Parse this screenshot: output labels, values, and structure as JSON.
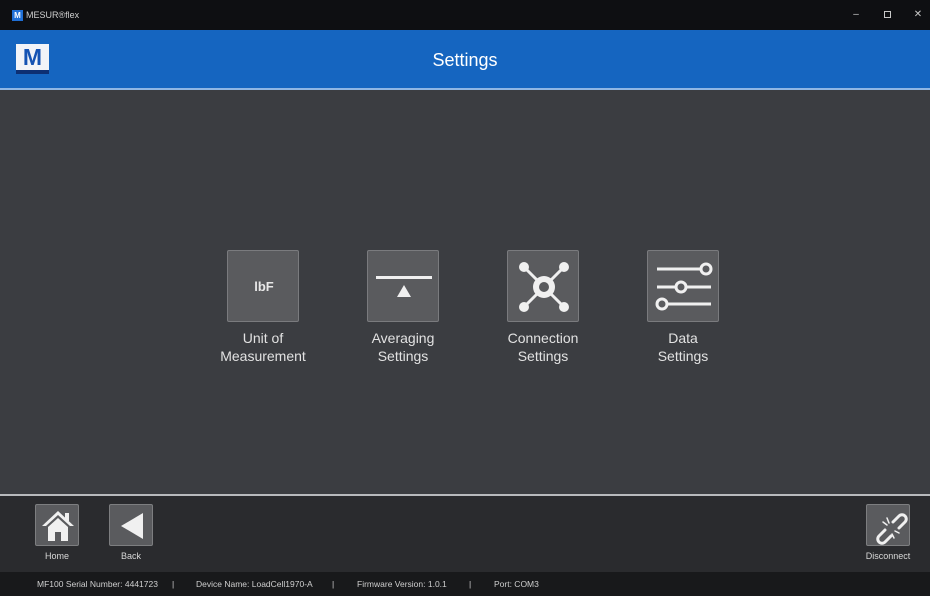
{
  "window": {
    "app_title": "MESUR®flex",
    "logo_letter": "M",
    "controls": {
      "minimize": "–",
      "close": "✕"
    }
  },
  "header": {
    "brand_letter": "M",
    "title": "Settings",
    "color": "#1565c0"
  },
  "tiles": [
    {
      "label": "Unit of\nMeasurement",
      "icon": "lbf-unit-icon",
      "icon_text": "lbF"
    },
    {
      "label": "Averaging\nSettings",
      "icon": "balance-scale-icon"
    },
    {
      "label": "Connection\nSettings",
      "icon": "network-hub-icon"
    },
    {
      "label": "Data\nSettings",
      "icon": "sliders-icon"
    }
  ],
  "nav": {
    "home_label": "Home",
    "back_label": "Back",
    "disconnect_label": "Disconnect"
  },
  "status": {
    "serial": "MF100 Serial Number: 4441723",
    "separator": "|",
    "device_name": "Device Name: LoadCell1970-A",
    "firmware": "Firmware Version: 1.0.1",
    "port": "Port: COM3"
  }
}
